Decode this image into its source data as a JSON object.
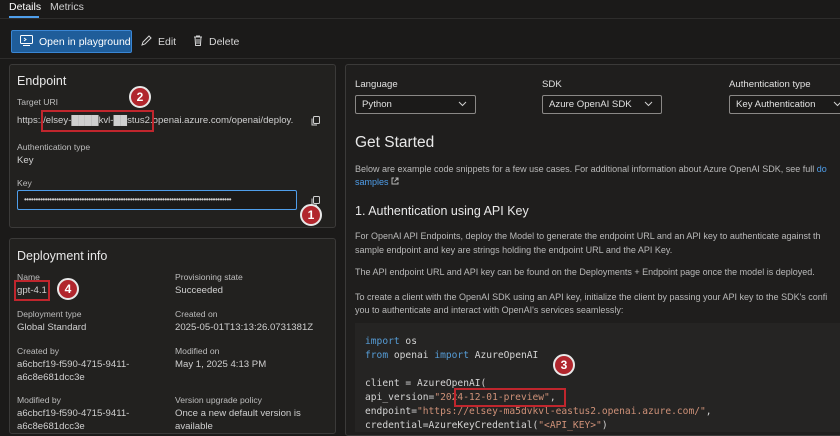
{
  "tabs": [
    {
      "label": "Details",
      "active": true
    },
    {
      "label": "Metrics",
      "active": false
    }
  ],
  "toolbar": {
    "open_playground_label": "Open in playground",
    "edit_label": "Edit",
    "delete_label": "Delete"
  },
  "endpoint": {
    "title": "Endpoint",
    "target_uri_label": "Target URI",
    "target_uri_value": "https://elsey-████kvl-██stus2.openai.azure.com/openai/deploy...",
    "auth_type_label": "Authentication type",
    "auth_type_value": "Key",
    "key_label": "Key",
    "key_value": "••••••••••••••••••••••••••••••••••••••••••••••••••••••••••••••••••••••••••••••••••••••••••"
  },
  "deployment": {
    "title": "Deployment info",
    "name_label": "Name",
    "name_value": "gpt-4.1",
    "provisioning_label": "Provisioning state",
    "provisioning_value": "Succeeded",
    "deployment_type_label": "Deployment type",
    "deployment_type_value": "Global Standard",
    "created_on_label": "Created on",
    "created_on_value": "2025-05-01T13:13:26.0731381Z",
    "created_by_label": "Created by",
    "created_by_line1": "a6cbcf19-f590-4715-9411-",
    "created_by_line2": "a6c8e681dcc3e",
    "modified_on_label": "Modified on",
    "modified_on_value": "May 1, 2025 4:13 PM",
    "modified_by_label": "Modified by",
    "modified_by_line1": "a6cbcf19-f590-4715-9411-",
    "modified_by_line2": "a6c8e681dcc3e",
    "upgrade_policy_label": "Version upgrade policy",
    "upgrade_policy_line1": "Once a new default version is",
    "upgrade_policy_line2": "available"
  },
  "code_panel": {
    "language_label": "Language",
    "language_value": "Python",
    "sdk_label": "SDK",
    "sdk_value": "Azure OpenAI SDK",
    "auth_label": "Authentication type",
    "auth_value": "Key Authentication",
    "heading": "Get Started",
    "intro_line1": "Below are example code snippets for a few use cases. For additional information about Azure OpenAI SDK, see full",
    "intro_link1": "do",
    "intro_link2": "samples",
    "section_heading": "1. Authentication using API Key",
    "p1_line1": "For OpenAI API Endpoints, deploy the Model to generate the endpoint URL and an API key to authenticate against th",
    "p1_line2": "sample endpoint and key are strings holding the endpoint URL and the API Key.",
    "p2_line1": "The API endpoint URL and API key can be found on the Deployments + Endpoint page once the model is deployed.",
    "p3_line1": "To create a client with the OpenAI SDK using an API key, initialize the client by passing your API key to the SDK's confi",
    "p3_line2": "you to authenticate and interact with OpenAI's services seamlessly:",
    "code_line1_kw": "import",
    "code_line1_rest": " os",
    "code_line2_kw1": "from",
    "code_line2_mid": " openai ",
    "code_line2_kw2": "import",
    "code_line2_rest": " AzureOpenAI",
    "code_line3": "client = AzureOpenAI(",
    "code_line4_prefix": "    api_version=",
    "code_line4_str": "\"2024-12-01-preview\"",
    "code_line4_suffix": ",",
    "code_line5_prefix": "    endpoint=",
    "code_line5_str": "\"https://elsey-ma5dvkvl-eastus2.openai.azure.com/\"",
    "code_line5_suffix": ",",
    "code_line6_prefix": "    credential=AzureKeyCredential(",
    "code_line6_str": "\"<API_KEY>\"",
    "code_line6_suffix": ")"
  },
  "annotations": [
    "1",
    "2",
    "3",
    "4"
  ],
  "colors": {
    "background": "#1b1a19",
    "card": "#22211f",
    "accent": "#4f9eea",
    "primary_button": "#1f5d9a",
    "annotation_red": "#c0262d"
  },
  "icons": [
    "playground-icon",
    "edit-icon",
    "delete-icon",
    "copy-icon",
    "chevron-down-icon",
    "external-link-icon"
  ]
}
